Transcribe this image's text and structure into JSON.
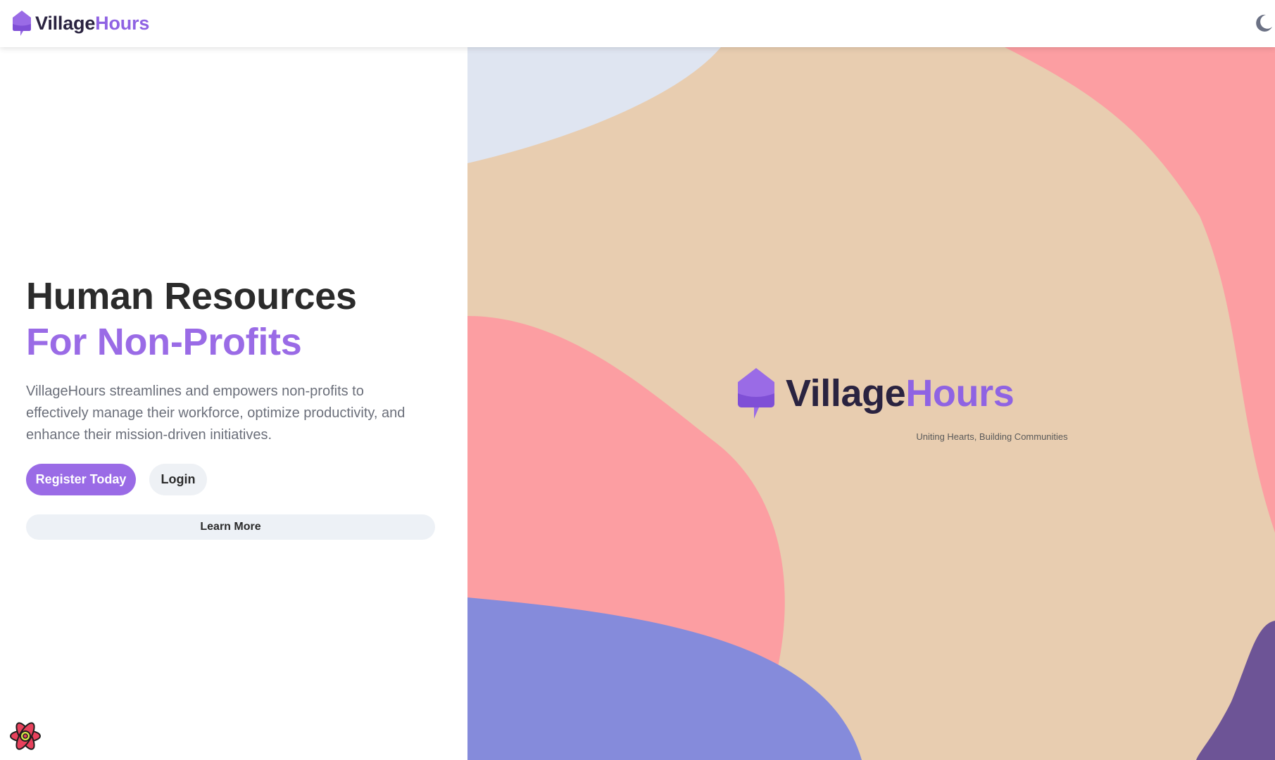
{
  "header": {
    "brand": {
      "part1": "Village",
      "part2": "Hours",
      "icon": "house-chat-icon"
    },
    "theme_toggle_icon": "moon-icon"
  },
  "hero": {
    "title_line1": "Human Resources",
    "title_line2": "For Non-Profits",
    "description": "VillageHours streamlines and empowers non-profits to effectively manage their workforce, optimize productivity, and enhance their mission-driven initiatives.",
    "register_label": "Register Today",
    "login_label": "Login",
    "learn_more_label": "Learn More"
  },
  "showcase": {
    "brand": {
      "part1": "Village",
      "part2": "Hours"
    },
    "tagline": "Uniting Hearts, Building Communities"
  },
  "colors": {
    "accent": "#9a6be6",
    "brand_dark": "#2a2340",
    "blob_tan": "#e8cdb0",
    "blob_pink": "#fc9ea2",
    "blob_blue": "#858bdb",
    "blob_light_blue": "#dfe5f1",
    "blob_purple": "#6d5496"
  },
  "devtools": {
    "icon": "react-devtools-icon"
  }
}
